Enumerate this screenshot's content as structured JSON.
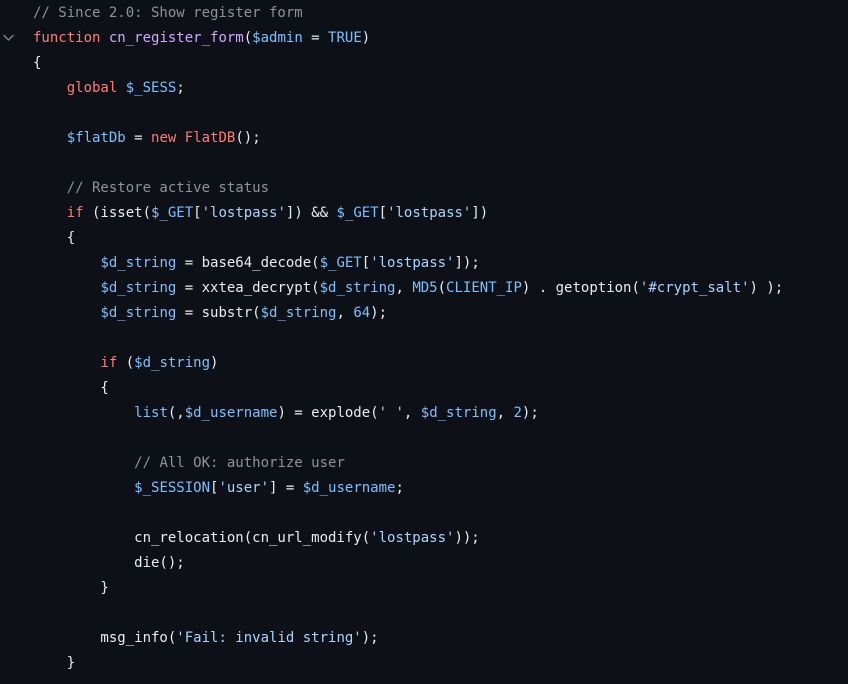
{
  "editor": {
    "lines": [
      {
        "fold": false,
        "tokens": [
          {
            "t": "comment",
            "v": "// Since 2.0: Show register form"
          }
        ]
      },
      {
        "fold": true,
        "tokens": [
          {
            "t": "keyword",
            "v": "function"
          },
          {
            "t": "plain",
            "v": " "
          },
          {
            "t": "fn",
            "v": "cn_register_form"
          },
          {
            "t": "plain",
            "v": "("
          },
          {
            "t": "var",
            "v": "$admin"
          },
          {
            "t": "plain",
            "v": " = "
          },
          {
            "t": "const",
            "v": "TRUE"
          },
          {
            "t": "plain",
            "v": ")"
          }
        ]
      },
      {
        "fold": false,
        "tokens": [
          {
            "t": "plain",
            "v": "{"
          }
        ]
      },
      {
        "fold": false,
        "tokens": [
          {
            "t": "plain",
            "v": "    "
          },
          {
            "t": "keyword",
            "v": "global"
          },
          {
            "t": "plain",
            "v": " "
          },
          {
            "t": "var",
            "v": "$_SESS"
          },
          {
            "t": "plain",
            "v": ";"
          }
        ]
      },
      {
        "fold": false,
        "tokens": []
      },
      {
        "fold": false,
        "tokens": [
          {
            "t": "plain",
            "v": "    "
          },
          {
            "t": "var",
            "v": "$flatDb"
          },
          {
            "t": "plain",
            "v": " = "
          },
          {
            "t": "keyword",
            "v": "new"
          },
          {
            "t": "plain",
            "v": " "
          },
          {
            "t": "keyword",
            "v": "FlatDB"
          },
          {
            "t": "plain",
            "v": "();"
          }
        ]
      },
      {
        "fold": false,
        "tokens": []
      },
      {
        "fold": false,
        "tokens": [
          {
            "t": "plain",
            "v": "    "
          },
          {
            "t": "comment",
            "v": "// Restore active status"
          }
        ]
      },
      {
        "fold": false,
        "tokens": [
          {
            "t": "plain",
            "v": "    "
          },
          {
            "t": "keyword",
            "v": "if"
          },
          {
            "t": "plain",
            "v": " (isset("
          },
          {
            "t": "var",
            "v": "$_GET"
          },
          {
            "t": "plain",
            "v": "["
          },
          {
            "t": "string",
            "v": "'lostpass'"
          },
          {
            "t": "plain",
            "v": "]) && "
          },
          {
            "t": "var",
            "v": "$_GET"
          },
          {
            "t": "plain",
            "v": "["
          },
          {
            "t": "string",
            "v": "'lostpass'"
          },
          {
            "t": "plain",
            "v": "])"
          }
        ]
      },
      {
        "fold": false,
        "tokens": [
          {
            "t": "plain",
            "v": "    {"
          }
        ]
      },
      {
        "fold": false,
        "tokens": [
          {
            "t": "plain",
            "v": "        "
          },
          {
            "t": "var",
            "v": "$d_string"
          },
          {
            "t": "plain",
            "v": " = base64_decode("
          },
          {
            "t": "var",
            "v": "$_GET"
          },
          {
            "t": "plain",
            "v": "["
          },
          {
            "t": "string",
            "v": "'lostpass'"
          },
          {
            "t": "plain",
            "v": "]);"
          }
        ]
      },
      {
        "fold": false,
        "tokens": [
          {
            "t": "plain",
            "v": "        "
          },
          {
            "t": "var",
            "v": "$d_string"
          },
          {
            "t": "plain",
            "v": " = xxtea_decrypt("
          },
          {
            "t": "var",
            "v": "$d_string"
          },
          {
            "t": "plain",
            "v": ", "
          },
          {
            "t": "const",
            "v": "MD5"
          },
          {
            "t": "plain",
            "v": "("
          },
          {
            "t": "const",
            "v": "CLIENT_IP"
          },
          {
            "t": "plain",
            "v": ") . getoption("
          },
          {
            "t": "string",
            "v": "'#crypt_salt'"
          },
          {
            "t": "plain",
            "v": ") );"
          }
        ]
      },
      {
        "fold": false,
        "tokens": [
          {
            "t": "plain",
            "v": "        "
          },
          {
            "t": "var",
            "v": "$d_string"
          },
          {
            "t": "plain",
            "v": " = substr("
          },
          {
            "t": "var",
            "v": "$d_string"
          },
          {
            "t": "plain",
            "v": ", "
          },
          {
            "t": "const",
            "v": "64"
          },
          {
            "t": "plain",
            "v": ");"
          }
        ]
      },
      {
        "fold": false,
        "tokens": []
      },
      {
        "fold": false,
        "tokens": [
          {
            "t": "plain",
            "v": "        "
          },
          {
            "t": "keyword",
            "v": "if"
          },
          {
            "t": "plain",
            "v": " ("
          },
          {
            "t": "var",
            "v": "$d_string"
          },
          {
            "t": "plain",
            "v": ")"
          }
        ]
      },
      {
        "fold": false,
        "tokens": [
          {
            "t": "plain",
            "v": "        {"
          }
        ]
      },
      {
        "fold": false,
        "tokens": [
          {
            "t": "plain",
            "v": "            "
          },
          {
            "t": "var",
            "v": "list"
          },
          {
            "t": "plain",
            "v": "(,"
          },
          {
            "t": "var",
            "v": "$d_username"
          },
          {
            "t": "plain",
            "v": ") = explode("
          },
          {
            "t": "string",
            "v": "' '"
          },
          {
            "t": "plain",
            "v": ", "
          },
          {
            "t": "var",
            "v": "$d_string"
          },
          {
            "t": "plain",
            "v": ", "
          },
          {
            "t": "const",
            "v": "2"
          },
          {
            "t": "plain",
            "v": ");"
          }
        ]
      },
      {
        "fold": false,
        "tokens": []
      },
      {
        "fold": false,
        "tokens": [
          {
            "t": "plain",
            "v": "            "
          },
          {
            "t": "comment",
            "v": "// All OK: authorize user"
          }
        ]
      },
      {
        "fold": false,
        "tokens": [
          {
            "t": "plain",
            "v": "            "
          },
          {
            "t": "var",
            "v": "$_SESSION"
          },
          {
            "t": "plain",
            "v": "["
          },
          {
            "t": "string",
            "v": "'user'"
          },
          {
            "t": "plain",
            "v": "] = "
          },
          {
            "t": "var",
            "v": "$d_username"
          },
          {
            "t": "plain",
            "v": ";"
          }
        ]
      },
      {
        "fold": false,
        "tokens": []
      },
      {
        "fold": false,
        "tokens": [
          {
            "t": "plain",
            "v": "            cn_relocation(cn_url_modify("
          },
          {
            "t": "string",
            "v": "'lostpass'"
          },
          {
            "t": "plain",
            "v": "));"
          }
        ]
      },
      {
        "fold": false,
        "tokens": [
          {
            "t": "plain",
            "v": "            die();"
          }
        ]
      },
      {
        "fold": false,
        "tokens": [
          {
            "t": "plain",
            "v": "        }"
          }
        ]
      },
      {
        "fold": false,
        "tokens": []
      },
      {
        "fold": false,
        "tokens": [
          {
            "t": "plain",
            "v": "        msg_info("
          },
          {
            "t": "string",
            "v": "'Fail: invalid string'"
          },
          {
            "t": "plain",
            "v": ");"
          }
        ]
      },
      {
        "fold": false,
        "tokens": [
          {
            "t": "plain",
            "v": "    }"
          }
        ]
      }
    ]
  },
  "colors": {
    "background": "#0d1117",
    "comment": "#8b949e",
    "keyword": "#ff7b72",
    "function": "#d2a8ff",
    "variable": "#79c0ff",
    "string": "#a5d6ff",
    "text": "#e6edf3"
  },
  "icons": {
    "fold": "chevron-down-icon"
  }
}
